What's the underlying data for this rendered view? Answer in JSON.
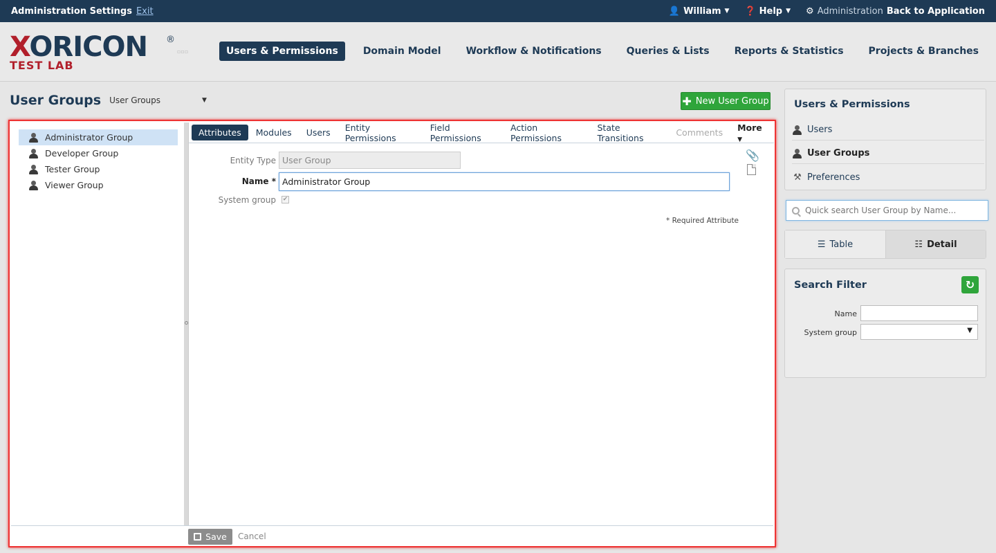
{
  "topbar": {
    "title": "Administration Settings",
    "exit": "Exit",
    "user": "William",
    "help": "Help",
    "admin": "Administration",
    "back": "Back to Application"
  },
  "logo": {
    "brand_x": "X",
    "brand_rest": "ORICON",
    "reg": "®",
    "sub": "TEST LAB"
  },
  "mainnav": [
    "Users & Permissions",
    "Domain Model",
    "Workflow & Notifications",
    "Queries & Lists",
    "Reports & Statistics",
    "Projects & Branches"
  ],
  "page": {
    "title": "User Groups",
    "view_select": "User Groups",
    "new_button": "New User Group"
  },
  "tree": [
    "Administrator Group",
    "Developer Group",
    "Tester Group",
    "Viewer Group"
  ],
  "tabs": [
    "Attributes",
    "Modules",
    "Users",
    "Entity Permissions",
    "Field Permissions",
    "Action Permissions",
    "State Transitions",
    "Comments"
  ],
  "tab_more": "More",
  "form": {
    "entity_type_label": "Entity Type",
    "entity_type_value": "User Group",
    "name_label": "Name",
    "name_value": "Administrator Group",
    "required_mark": "*",
    "system_group_label": "System group",
    "required_note": "* Required Attribute"
  },
  "footer": {
    "save": "Save",
    "cancel": "Cancel"
  },
  "sidebar": {
    "header": "Users & Permissions",
    "links": [
      "Users",
      "User Groups",
      "Preferences"
    ],
    "search_placeholder": "Quick search User Group by Name...",
    "view_table": "Table",
    "view_detail": "Detail",
    "filter_header": "Search Filter",
    "filter_name": "Name",
    "filter_system_group": "System group"
  },
  "colors": {
    "navy": "#1e3a55",
    "accent_red": "#b11f2b",
    "green": "#2fa53b",
    "highlight": "#e33333"
  }
}
